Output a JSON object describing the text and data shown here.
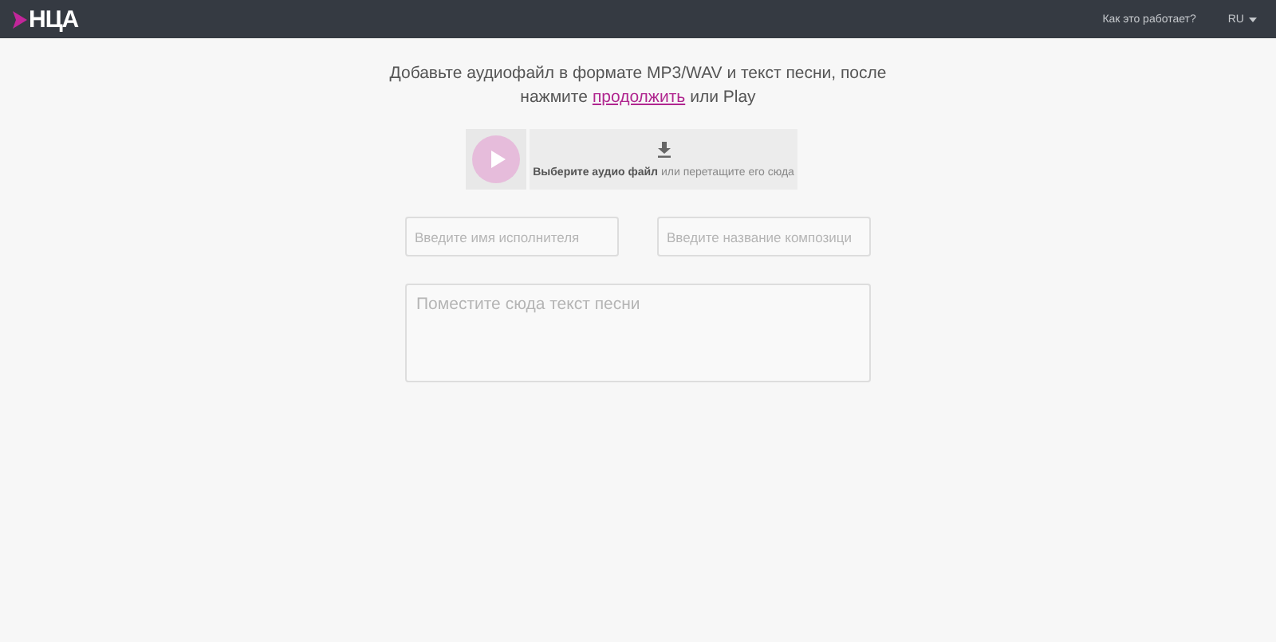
{
  "header": {
    "logo": "НЦА",
    "nav_link": "Как это работает?",
    "language": "RU"
  },
  "intro": {
    "line_1": "Добавьте аудиофайл в формате MP3/WAV и текст песни, после",
    "before_link": "нажмите",
    "link": "продолжить",
    "after_link": "или Play"
  },
  "upload": {
    "action": "Выберите аудио файл",
    "hint": "или перетащите его сюда"
  },
  "fields": {
    "artist_placeholder": "Введите имя исполнителя",
    "title_placeholder": "Введите название композици",
    "lyrics_placeholder": "Поместите сюда текст песни"
  }
}
